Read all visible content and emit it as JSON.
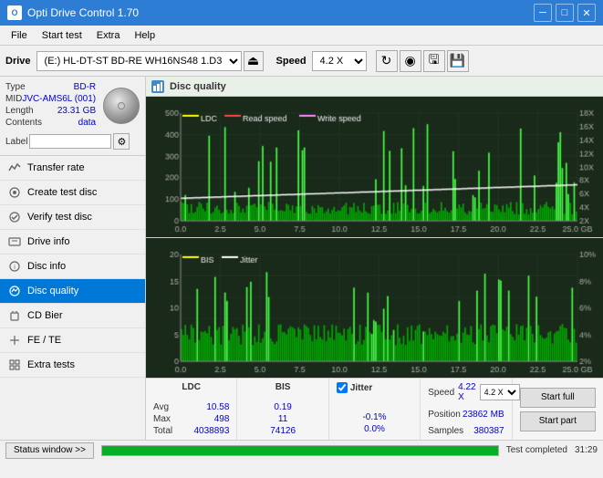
{
  "titleBar": {
    "title": "Opti Drive Control 1.70",
    "icon": "O",
    "minBtn": "─",
    "maxBtn": "□",
    "closeBtn": "✕"
  },
  "menuBar": {
    "items": [
      "File",
      "Start test",
      "Extra",
      "Help"
    ]
  },
  "driveToolbar": {
    "driveLabel": "Drive",
    "driveValue": "(E:)  HL-DT-ST BD-RE  WH16NS48 1.D3",
    "speedLabel": "Speed",
    "speedValue": "4.2 X",
    "ejectSymbol": "⏏"
  },
  "disc": {
    "typeLabel": "Type",
    "typeValue": "BD-R",
    "midLabel": "MID",
    "midValue": "JVC-AMS6L (001)",
    "lengthLabel": "Length",
    "lengthValue": "23.31 GB",
    "contentsLabel": "Contents",
    "contentsValue": "data",
    "labelLabel": "Label",
    "labelValue": "",
    "labelPlaceholder": ""
  },
  "nav": {
    "items": [
      {
        "id": "transfer-rate",
        "label": "Transfer rate",
        "icon": "chart"
      },
      {
        "id": "create-test-disc",
        "label": "Create test disc",
        "icon": "disc"
      },
      {
        "id": "verify-test-disc",
        "label": "Verify test disc",
        "icon": "check"
      },
      {
        "id": "drive-info",
        "label": "Drive info",
        "icon": "info"
      },
      {
        "id": "disc-info",
        "label": "Disc info",
        "icon": "disc-info"
      },
      {
        "id": "disc-quality",
        "label": "Disc quality",
        "icon": "quality",
        "active": true
      },
      {
        "id": "cd-bier",
        "label": "CD Bier",
        "icon": "beer"
      },
      {
        "id": "fe-te",
        "label": "FE / TE",
        "icon": "fe-te"
      },
      {
        "id": "extra-tests",
        "label": "Extra tests",
        "icon": "extra"
      }
    ]
  },
  "chartPanel": {
    "title": "Disc quality",
    "iconColor": "#4488cc"
  },
  "upperChart": {
    "yAxisMax": 500,
    "yAxisLabels": [
      "500",
      "400",
      "300",
      "200",
      "100"
    ],
    "yAxisRight": [
      "18X",
      "16X",
      "14X",
      "12X",
      "10X",
      "8X",
      "6X",
      "4X",
      "2X"
    ],
    "xAxisLabels": [
      "0.0",
      "2.5",
      "5.0",
      "7.5",
      "10.0",
      "12.5",
      "15.0",
      "17.5",
      "20.0",
      "22.5",
      "25.0 GB"
    ],
    "legend": [
      {
        "label": "LDC",
        "color": "#ffff00"
      },
      {
        "label": "Read speed",
        "color": "#ff0000"
      },
      {
        "label": "Write speed",
        "color": "#ff88ff"
      }
    ]
  },
  "lowerChart": {
    "yAxisMax": 20,
    "yAxisLabels": [
      "20",
      "15",
      "10",
      "5"
    ],
    "yAxisRight": [
      "10%",
      "8%",
      "6%",
      "4%",
      "2%"
    ],
    "xAxisLabels": [
      "0.0",
      "2.5",
      "5.0",
      "7.5",
      "10.0",
      "12.5",
      "15.0",
      "17.5",
      "20.0",
      "22.5",
      "25.0 GB"
    ],
    "legend": [
      {
        "label": "BIS",
        "color": "#ffff00"
      },
      {
        "label": "Jitter",
        "color": "#ffffff"
      }
    ]
  },
  "stats": {
    "columns": [
      {
        "header": "LDC",
        "avg": "10.58",
        "max": "498",
        "total": "4038893"
      },
      {
        "header": "BIS",
        "avg": "0.19",
        "max": "11",
        "total": "74126"
      },
      {
        "jitterCheck": true,
        "header": "Jitter",
        "avg": "-0.1%",
        "max": "0.0%",
        "total": ""
      },
      {
        "header": "Speed",
        "speedVal": "4.22 X",
        "speedSelect": "4.2 X",
        "posLabel": "Position",
        "posVal": "23862 MB",
        "samplesLabel": "Samples",
        "samplesVal": "380387"
      }
    ],
    "rowLabels": [
      "Avg",
      "Max",
      "Total"
    ],
    "startFull": "Start full",
    "startPart": "Start part"
  },
  "statusBar": {
    "statusWindowBtn": "Status window >>",
    "progressPercent": 100,
    "statusText": "Test completed",
    "timeText": "31:29"
  }
}
